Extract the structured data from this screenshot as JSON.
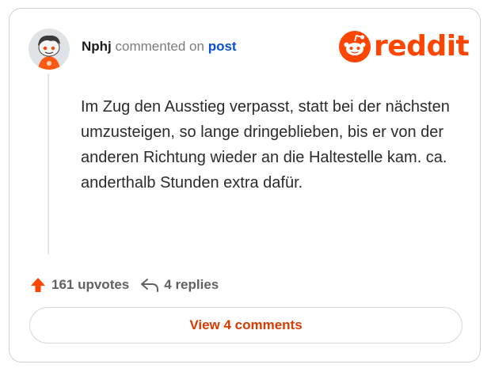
{
  "comment": {
    "username": "Nphj",
    "action_text": "commented on",
    "post_link": "post",
    "body": "Im Zug den Ausstieg verpasst, statt bei der nächsten umzusteigen, so lange dringeblieben, bis er von der anderen Richtung wieder an die Haltestelle kam. ca. anderthalb Stunden extra dafür."
  },
  "brand": {
    "name": "reddit",
    "color": "#ff4500"
  },
  "stats": {
    "upvotes": "161 upvotes",
    "replies": "4 replies"
  },
  "actions": {
    "view_comments": "View 4 comments"
  },
  "icons": {
    "upvote": "upvote-arrow-icon",
    "reply": "reply-arrow-icon",
    "logo": "reddit-snoo-icon"
  }
}
